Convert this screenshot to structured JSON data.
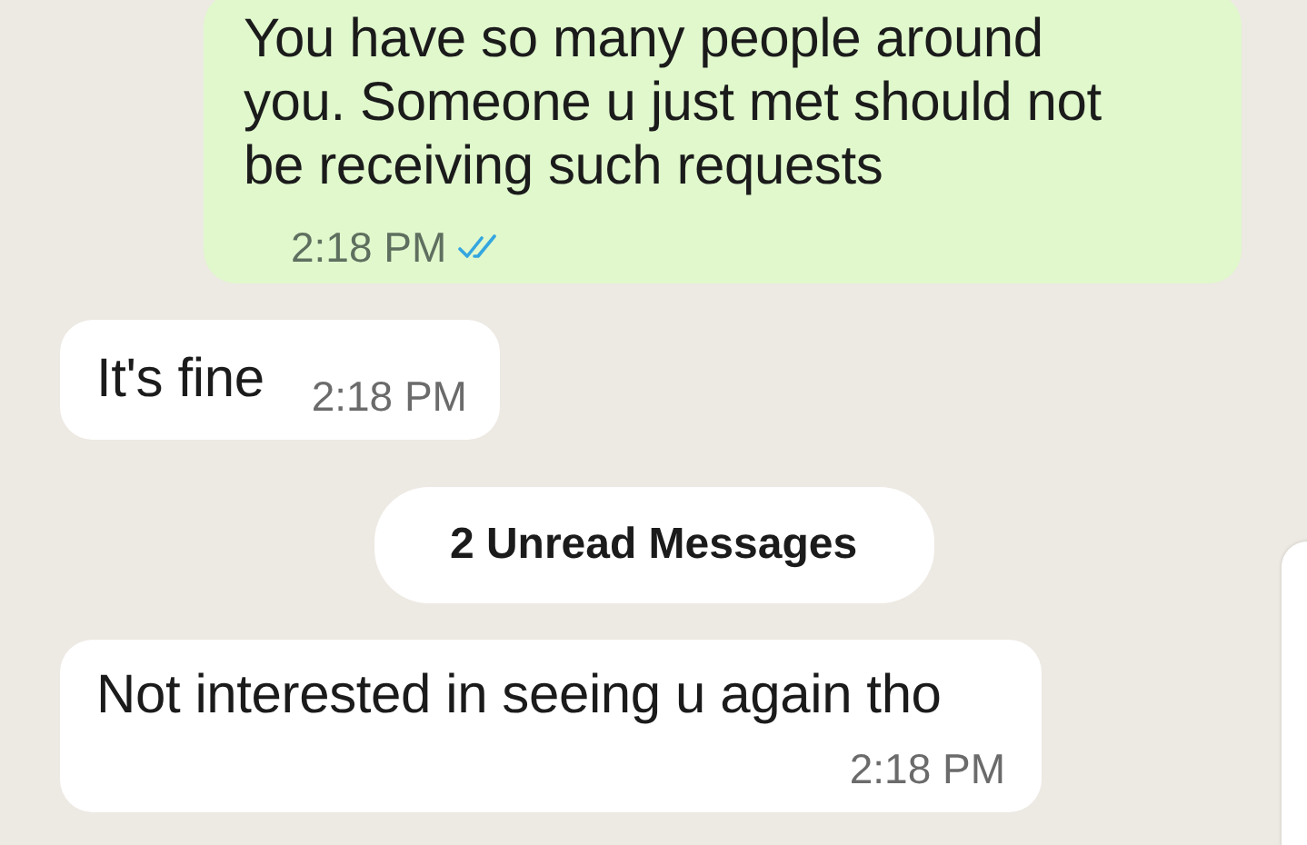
{
  "messages": [
    {
      "kind": "outgoing",
      "text": "You have so many people around you. Someone u just met should not be receiving such requests",
      "time": "2:18 PM",
      "read": true
    },
    {
      "kind": "incoming",
      "text": "It's fine",
      "time": "2:18 PM"
    },
    {
      "kind": "divider",
      "text": "2 Unread Messages"
    },
    {
      "kind": "incoming_long",
      "text": "Not interested in seeing u again tho",
      "time": "2:18 PM"
    }
  ]
}
